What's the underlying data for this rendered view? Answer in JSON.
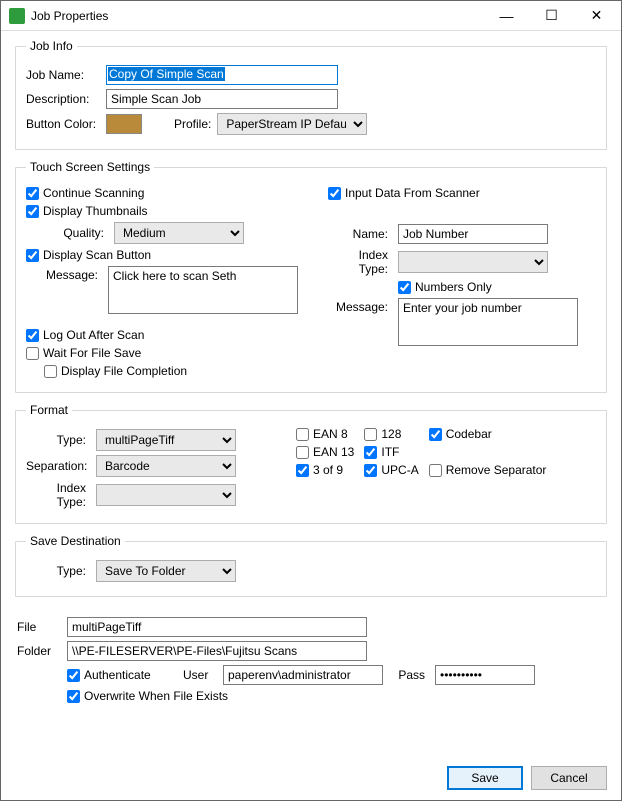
{
  "window": {
    "title": "Job Properties",
    "controls": {
      "min": "—",
      "max": "☐",
      "close": "✕"
    }
  },
  "jobInfo": {
    "legend": "Job Info",
    "jobName_label": "Job Name:",
    "jobName_value": "Copy Of Simple Scan",
    "description_label": "Description:",
    "description_value": "Simple Scan Job",
    "buttonColor_label": "Button Color:",
    "buttonColor_value": "#b88a3a",
    "profile_label": "Profile:",
    "profile_value": "PaperStream IP Default"
  },
  "touch": {
    "legend": "Touch Screen Settings",
    "continueScanning": "Continue Scanning",
    "displayThumbnails": "Display Thumbnails",
    "quality_label": "Quality:",
    "quality_value": "Medium",
    "displayScanButton": "Display Scan Button",
    "message_label": "Message:",
    "message_value": "Click here to scan Seth",
    "logOutAfterScan": "Log Out After Scan",
    "waitForFileSave": "Wait For File Save",
    "displayFileCompletion": "Display File Completion",
    "inputDataFromScanner": "Input Data From Scanner",
    "name_label": "Name:",
    "name_value": "Job Number",
    "indexType_label": "Index Type:",
    "indexType_value": "",
    "numbersOnly": "Numbers Only",
    "message2_label": "Message:",
    "message2_value": "Enter your job number"
  },
  "format": {
    "legend": "Format",
    "type_label": "Type:",
    "type_value": "multiPageTiff",
    "separation_label": "Separation:",
    "separation_value": "Barcode",
    "indexType_label": "Index Type:",
    "indexType_value": "",
    "ean8": "EAN 8",
    "ean13": "EAN 13",
    "threeOf9": "3 of 9",
    "oneTwoEight": "128",
    "itf": "ITF",
    "upca": "UPC-A",
    "codebar": "Codebar",
    "removeSeparator": "Remove Separator"
  },
  "saveDest": {
    "legend": "Save Destination",
    "type_label": "Type:",
    "type_value": "Save To Folder"
  },
  "save": {
    "file_label": "File",
    "file_value": "multiPageTiff",
    "folder_label": "Folder",
    "folder_value": "\\\\PE-FILESERVER\\PE-Files\\Fujitsu Scans",
    "authenticate": "Authenticate",
    "user_label": "User",
    "user_value": "paperenv\\administrator",
    "pass_label": "Pass",
    "pass_value": "**********",
    "overwrite": "Overwrite When File Exists"
  },
  "buttons": {
    "save": "Save",
    "cancel": "Cancel"
  }
}
